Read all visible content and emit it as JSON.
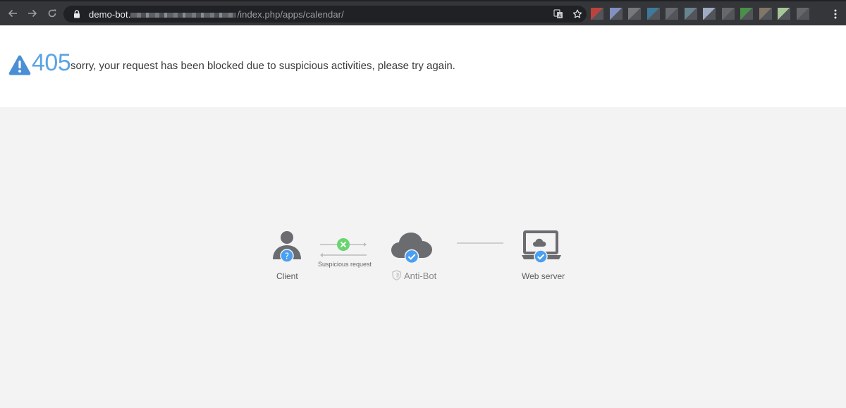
{
  "browser": {
    "url_host": "demo-bot.",
    "url_path": "/index.php/apps/calendar/",
    "extension_colors": [
      "#c9463d",
      "#8a9bd1",
      "#7d7f83",
      "#3f7fa6",
      "#6d7075",
      "#6f8c99",
      "#aab8d1",
      "#6c6e72",
      "#4c9a4c",
      "#8b7d6b",
      "#b4d6a3",
      "#6a6c70"
    ]
  },
  "error": {
    "code": "405",
    "message": "sorry, your request has been blocked due to suspicious activities, please try again."
  },
  "diagram": {
    "client_label": "Client",
    "request_label": "Suspicious request",
    "antibot_label": "Anti-Bot",
    "server_label": "Web server"
  },
  "colors": {
    "accent_blue": "#4a9ff0",
    "block_green": "#6ad46f",
    "icon_gray": "#6b6c70",
    "code_blue": "#5aa3e6"
  }
}
